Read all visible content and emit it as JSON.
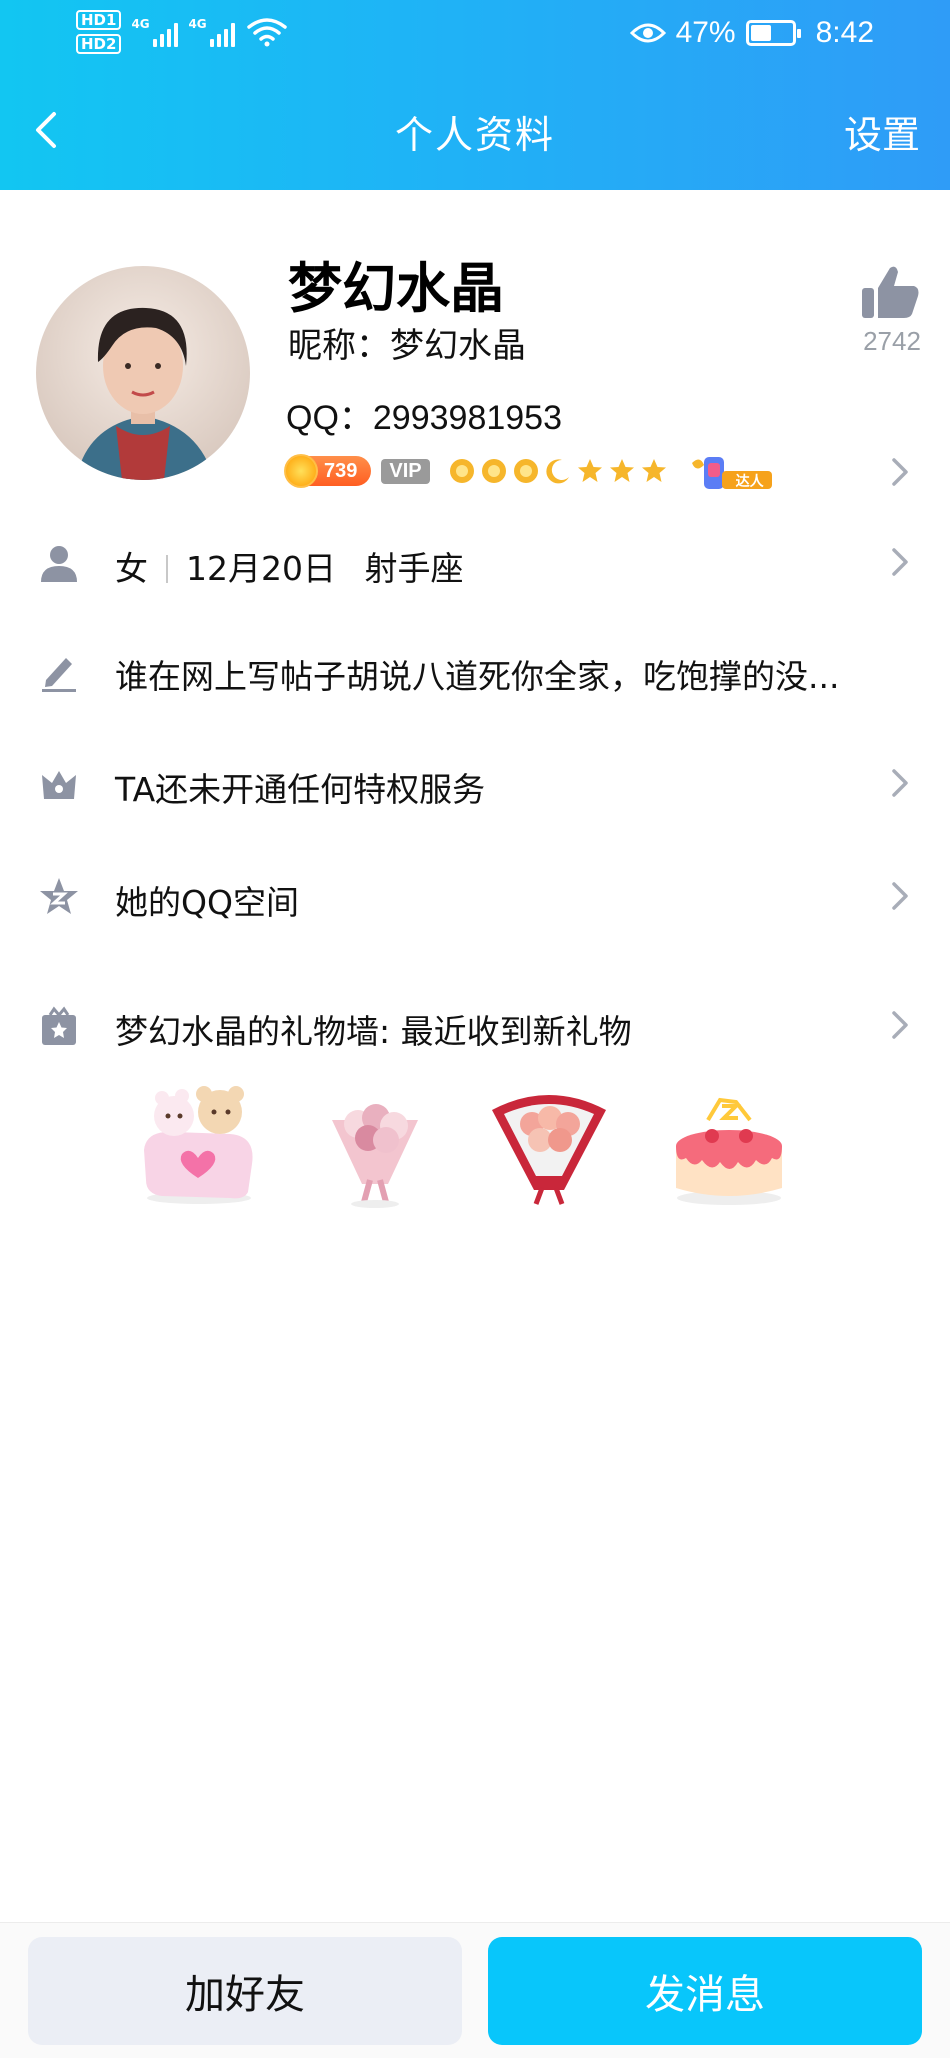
{
  "status_bar": {
    "hd1": "HD",
    "hd1_sub": "1",
    "hd2": "HD",
    "hd2_sub": "2",
    "net1": "4G",
    "net2": "4G",
    "battery_percent": "47%",
    "battery_level": 0.47,
    "time": "8:42"
  },
  "nav": {
    "back_icon": "chevron-left-icon",
    "title": "个人资料",
    "settings": "设置"
  },
  "profile": {
    "name": "梦幻水晶",
    "nickname": "昵称：梦幻水晶",
    "qq": "QQ：2993981953",
    "like_count": "2742",
    "badges": {
      "coin_value": "739",
      "vip": "VIP",
      "talent_label": "达人"
    }
  },
  "rows": {
    "basic": {
      "gender": "女",
      "birthday": "12月20日",
      "zodiac": "射手座"
    },
    "signature": "谁在网上写帖子胡说八道死你全家，吃饱撑的没...",
    "privilege": "TA还未开通任何特权服务",
    "qzone": "她的QQ空间",
    "gift_wall": "梦幻水晶的礼物墙: 最近收到新礼物"
  },
  "bottom": {
    "add_friend": "加好友",
    "send_message": "发消息"
  },
  "colors": {
    "header_start": "#12c6f2",
    "header_end": "#2f9cf7",
    "primary_button": "#08c6fb",
    "secondary_button": "#ebeef5",
    "icon_gray": "#8d93a3"
  }
}
